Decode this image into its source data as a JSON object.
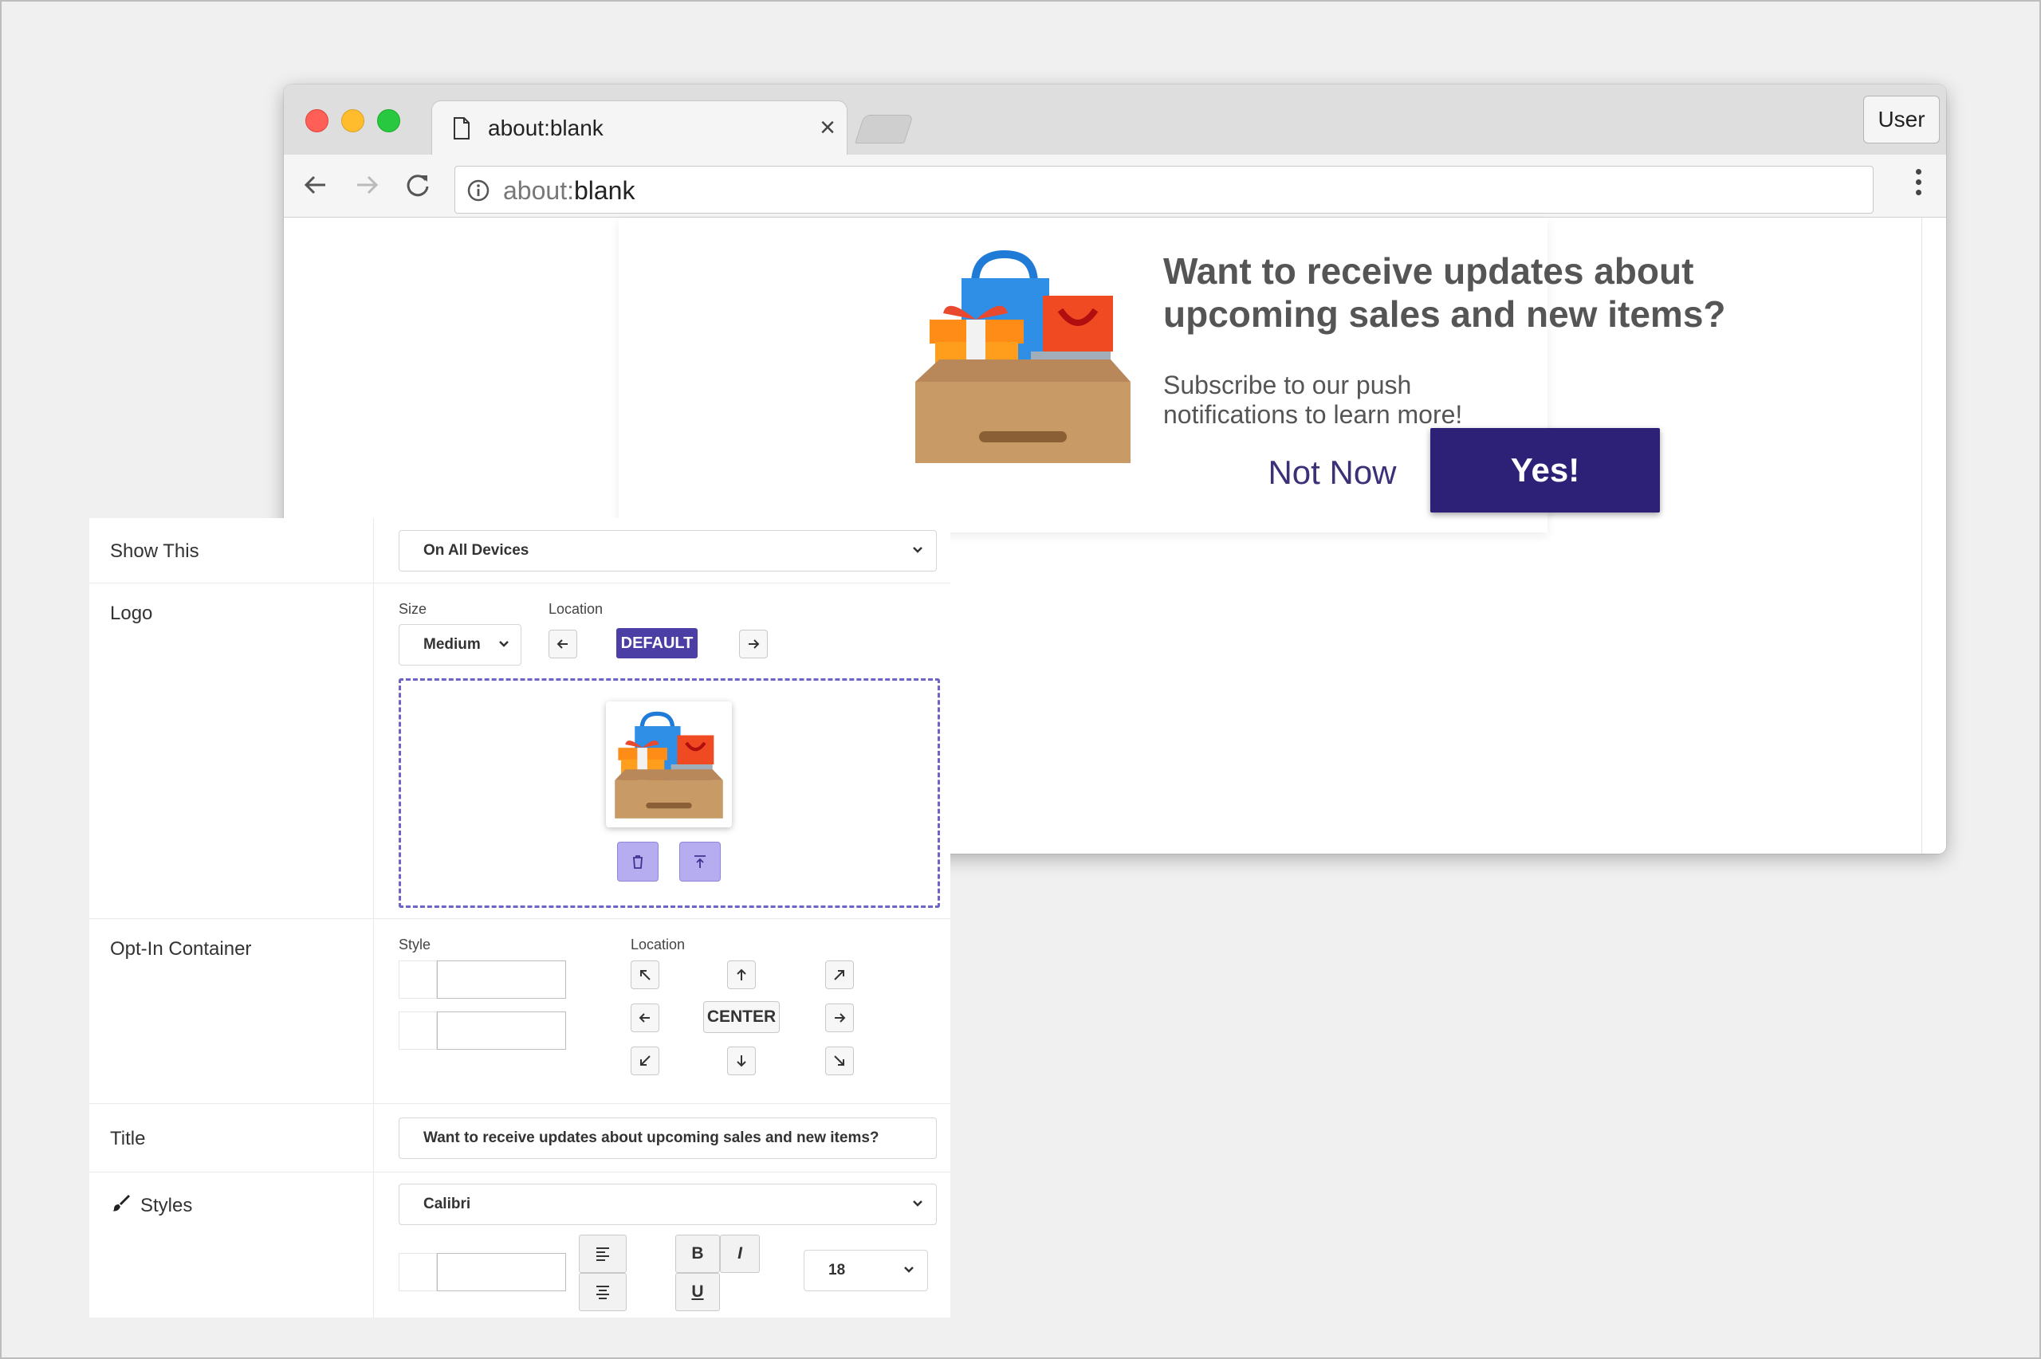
{
  "browser": {
    "tab_title": "about:blank",
    "close_glyph": "×",
    "user_button": "User",
    "url_scheme": "about:",
    "url_path": "blank"
  },
  "popup": {
    "title": "Want to receive updates about upcoming sales and new items?",
    "subtitle": "Subscribe to our push notifications to learn more!",
    "decline_label": "Not Now",
    "accept_label": "Yes!",
    "accent_color": "#2c2177"
  },
  "settings": {
    "show_this": {
      "label": "Show This",
      "value": "On All Devices"
    },
    "logo": {
      "label": "Logo",
      "size_label": "Size",
      "size_value": "Medium",
      "location_label": "Location",
      "location_value": "DEFAULT"
    },
    "opt_in_container": {
      "label": "Opt-In Container",
      "style_label": "Style",
      "location_label": "Location",
      "center_label": "CENTER"
    },
    "title": {
      "label": "Title",
      "value": "Want to receive updates about upcoming sales and new items?"
    },
    "styles": {
      "label": "Styles",
      "font_value": "Calibri",
      "bold": "B",
      "italic": "I",
      "underline": "U",
      "font_size": "18"
    }
  }
}
